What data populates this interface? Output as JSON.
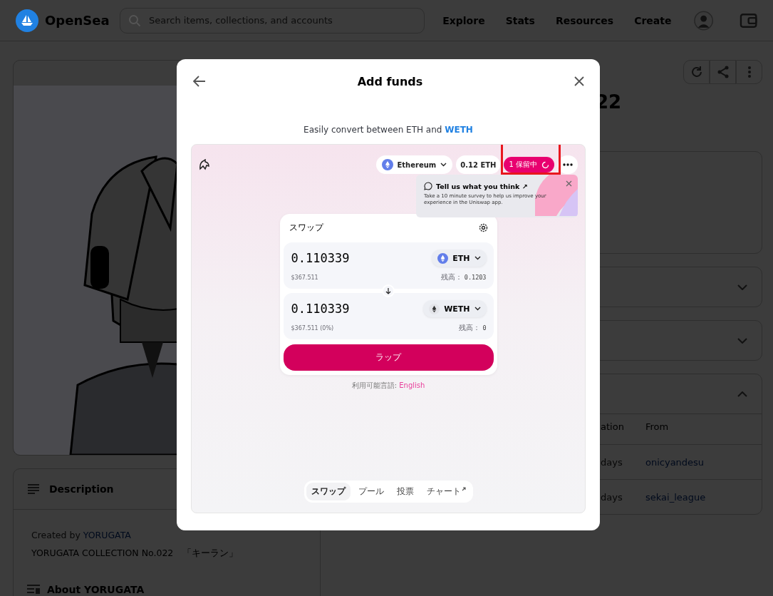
{
  "header": {
    "logo": "OpenSea",
    "search": {
      "placeholder": "Search items, collections, and accounts"
    },
    "nav": [
      "Explore",
      "Stats",
      "Resources",
      "Create"
    ]
  },
  "item": {
    "title": "22",
    "description": {
      "title": "Description",
      "created_prefix": "Created by",
      "creator": "YORUGATA",
      "text": "YORUGATA COLLECTION No.022　「キーラン」"
    },
    "about": "About YORUGATA",
    "accordions": [
      {
        "expanded": false
      },
      {
        "expanded": false
      },
      {
        "expanded": true
      }
    ],
    "table": {
      "columns": [
        "ation",
        "From"
      ],
      "rows": [
        {
          "column_1": "days",
          "from": "onicyandesu"
        },
        {
          "column_1": "days",
          "from": "sekai_league"
        }
      ]
    }
  },
  "modal": {
    "title": "Add funds",
    "subtitle": "Easily convert between ETH and",
    "subtitle_link": "WETH",
    "widget": {
      "network": "Ethereum",
      "balance": "0.12 ETH",
      "pending": "1 保留中",
      "survey": {
        "title": "Tell us what you think ↗",
        "body": "Take a 10 minute survey to help us improve your experience in the Uniswap app."
      },
      "swap": {
        "title": "スワップ",
        "fields": [
          {
            "amount": "0.110339",
            "usd": "$367.511",
            "token": "ETH",
            "balance_label": "残高：",
            "balance": "0.1203"
          },
          {
            "amount": "0.110339",
            "usd": "$367.511 (0%)",
            "token": "WETH",
            "balance_label": "残高：",
            "balance": "0"
          }
        ],
        "button": "ラップ"
      },
      "languages_label": "利用可能言語:",
      "language": "English",
      "tabs": [
        {
          "label": "スワップ",
          "selected": true,
          "external": false
        },
        {
          "label": "プール",
          "selected": false,
          "external": false
        },
        {
          "label": "投票",
          "selected": false,
          "external": false
        },
        {
          "label": "チャート",
          "selected": false,
          "external": true
        }
      ]
    }
  }
}
